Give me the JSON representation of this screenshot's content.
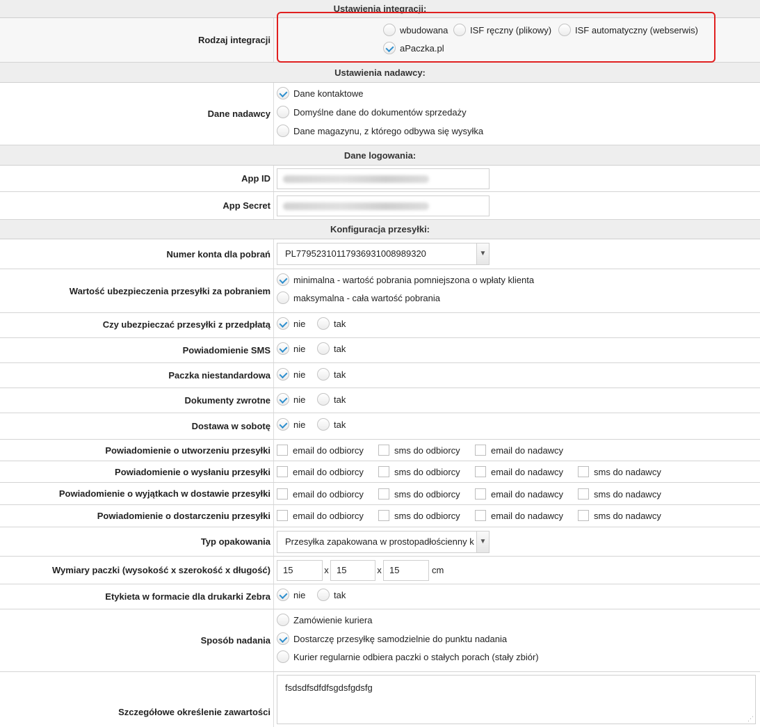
{
  "integration": {
    "section_title": "Ustawienia integracji:",
    "label": "Rodzaj integracji",
    "options": [
      "wbudowana",
      "ISF ręczny (plikowy)",
      "ISF automatyczny (webserwis)",
      "aPaczka.pl"
    ],
    "selected": "aPaczka.pl"
  },
  "sender": {
    "section_title": "Ustawienia nadawcy:",
    "label": "Dane nadawcy",
    "options": [
      "Dane kontaktowe",
      "Domyślne dane do dokumentów sprzedaży",
      "Dane magazynu, z którego odbywa się wysyłka"
    ],
    "selected": "Dane kontaktowe"
  },
  "login": {
    "section_title": "Dane logowania:",
    "app_id_label": "App ID",
    "app_secret_label": "App Secret"
  },
  "shipping": {
    "section_title": "Konfiguracja przesyłki:",
    "account_label": "Numer konta dla pobrań",
    "account_value": "PL77952310117936931008989320",
    "insurance_label": "Wartość ubezpieczenia przesyłki za pobraniem",
    "insurance_options": [
      "minimalna - wartość pobrania pomniejszona o wpłaty klienta",
      "maksymalna - cała wartość pobrania"
    ],
    "insurance_selected": "minimalna - wartość pobrania pomniejszona o wpłaty klienta",
    "prepaid_label": "Czy ubezpieczać przesyłki z przedpłatą",
    "sms_label": "Powiadomienie SMS",
    "nonstandard_label": "Paczka niestandardowa",
    "return_docs_label": "Dokumenty zwrotne",
    "saturday_label": "Dostawa w sobotę",
    "no": "nie",
    "yes": "tak",
    "notif_created_label": "Powiadomienie o utworzeniu przesyłki",
    "notif_sent_label": "Powiadomienie o wysłaniu przesyłki",
    "notif_exceptions_label": "Powiadomienie o wyjątkach w dostawie przesyłki",
    "notif_delivered_label": "Powiadomienie o dostarczeniu przesyłki",
    "email_recipient": "email do odbiorcy",
    "sms_recipient": "sms do odbiorcy",
    "email_sender": "email do nadawcy",
    "sms_sender": "sms do nadawcy",
    "package_type_label": "Typ opakowania",
    "package_type_value": "Przesyłka zapakowana w prostopadłościenny k",
    "dimensions_label": "Wymiary paczki (wysokość x szerokość x długość)",
    "dim_height": "15",
    "dim_width": "15",
    "dim_length": "15",
    "dim_sep": "x",
    "dim_unit": "cm",
    "zebra_label": "Etykieta w formacie dla drukarki Zebra",
    "dispatch_label": "Sposób nadania",
    "dispatch_options": [
      "Zamówienie kuriera",
      "Dostarczę przesyłkę samodzielnie do punktu nadania",
      "Kurier regularnie odbiera paczki o stałych porach (stały zbiór)"
    ],
    "dispatch_selected": "Dostarczę przesyłkę samodzielnie do punktu nadania",
    "contents_label": "Szczegółowe określenie zawartości",
    "contents_value": "fsdsdfsdfdfsgdsfgdsfg"
  }
}
